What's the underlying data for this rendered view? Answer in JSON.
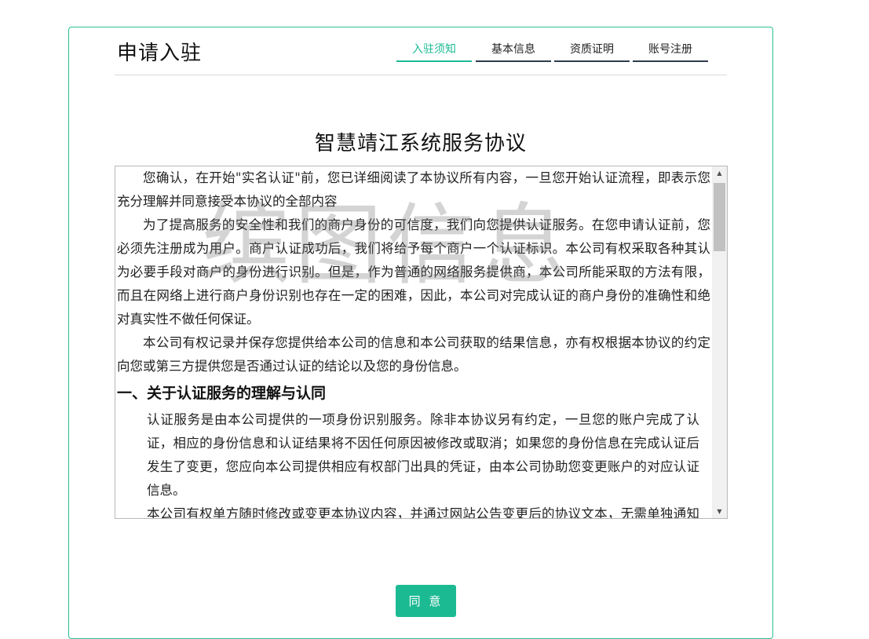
{
  "header": {
    "title": "申请入驻",
    "tabs": [
      {
        "label": "入驻须知",
        "active": true
      },
      {
        "label": "基本信息",
        "active": false
      },
      {
        "label": "资质证明",
        "active": false
      },
      {
        "label": "账号注册",
        "active": false
      }
    ]
  },
  "agreement": {
    "title": "智慧靖江系统服务协议",
    "watermark": "缤图信息",
    "paragraphs": [
      "您确认，在开始\"实名认证\"前，您已详细阅读了本协议所有内容，一旦您开始认证流程，即表示您充分理解并同意接受本协议的全部内容",
      "为了提高服务的安全性和我们的商户身份的可信度，我们向您提供认证服务。在您申请认证前，您必须先注册成为用户。商户认证成功后，我们将给予每个商户一个认证标识。本公司有权采取各种其认为必要手段对商户的身份进行识别。但是，作为普通的网络服务提供商，本公司所能采取的方法有限，而且在网络上进行商户身份识别也存在一定的困难，因此，本公司对完成认证的商户身份的准确性和绝对真实性不做任何保证。",
      "本公司有权记录并保存您提供给本公司的信息和本公司获取的结果信息，亦有权根据本协议的约定向您或第三方提供您是否通过认证的结论以及您的身份信息。"
    ],
    "section1_heading": "一、关于认证服务的理解与认同",
    "section1_paragraphs": [
      "认证服务是由本公司提供的一项身份识别服务。除非本协议另有约定，一旦您的账户完成了认证，相应的身份信息和认证结果将不因任何原因被修改或取消；如果您的身份信息在完成认证后发生了变更，您应向本公司提供相应有权部门出具的凭证，由本公司协助您变更账户的对应认证信息。",
      "本公司有权单方随时修改或变更本协议内容，并通过网站公告变更后的协议文本，无需单独通知您。"
    ]
  },
  "scrollbar": {
    "up_arrow": "▲",
    "down_arrow": "▼"
  },
  "actions": {
    "agree_label": "同 意"
  },
  "colors": {
    "accent": "#1cba93",
    "tab_underline": "#2f3b4c",
    "card_border": "#2bbf94"
  }
}
